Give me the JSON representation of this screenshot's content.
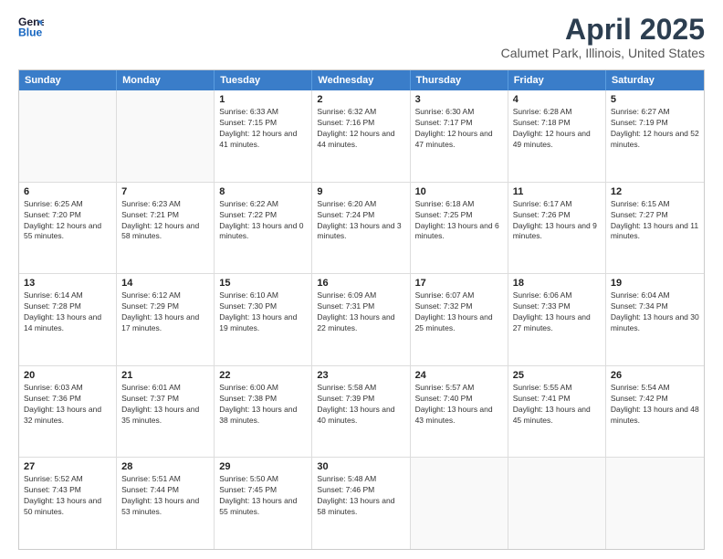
{
  "header": {
    "logo_line1": "General",
    "logo_line2": "Blue",
    "month_title": "April 2025",
    "location": "Calumet Park, Illinois, United States"
  },
  "days_of_week": [
    "Sunday",
    "Monday",
    "Tuesday",
    "Wednesday",
    "Thursday",
    "Friday",
    "Saturday"
  ],
  "weeks": [
    [
      {
        "day": "",
        "text": ""
      },
      {
        "day": "",
        "text": ""
      },
      {
        "day": "1",
        "text": "Sunrise: 6:33 AM\nSunset: 7:15 PM\nDaylight: 12 hours and 41 minutes."
      },
      {
        "day": "2",
        "text": "Sunrise: 6:32 AM\nSunset: 7:16 PM\nDaylight: 12 hours and 44 minutes."
      },
      {
        "day": "3",
        "text": "Sunrise: 6:30 AM\nSunset: 7:17 PM\nDaylight: 12 hours and 47 minutes."
      },
      {
        "day": "4",
        "text": "Sunrise: 6:28 AM\nSunset: 7:18 PM\nDaylight: 12 hours and 49 minutes."
      },
      {
        "day": "5",
        "text": "Sunrise: 6:27 AM\nSunset: 7:19 PM\nDaylight: 12 hours and 52 minutes."
      }
    ],
    [
      {
        "day": "6",
        "text": "Sunrise: 6:25 AM\nSunset: 7:20 PM\nDaylight: 12 hours and 55 minutes."
      },
      {
        "day": "7",
        "text": "Sunrise: 6:23 AM\nSunset: 7:21 PM\nDaylight: 12 hours and 58 minutes."
      },
      {
        "day": "8",
        "text": "Sunrise: 6:22 AM\nSunset: 7:22 PM\nDaylight: 13 hours and 0 minutes."
      },
      {
        "day": "9",
        "text": "Sunrise: 6:20 AM\nSunset: 7:24 PM\nDaylight: 13 hours and 3 minutes."
      },
      {
        "day": "10",
        "text": "Sunrise: 6:18 AM\nSunset: 7:25 PM\nDaylight: 13 hours and 6 minutes."
      },
      {
        "day": "11",
        "text": "Sunrise: 6:17 AM\nSunset: 7:26 PM\nDaylight: 13 hours and 9 minutes."
      },
      {
        "day": "12",
        "text": "Sunrise: 6:15 AM\nSunset: 7:27 PM\nDaylight: 13 hours and 11 minutes."
      }
    ],
    [
      {
        "day": "13",
        "text": "Sunrise: 6:14 AM\nSunset: 7:28 PM\nDaylight: 13 hours and 14 minutes."
      },
      {
        "day": "14",
        "text": "Sunrise: 6:12 AM\nSunset: 7:29 PM\nDaylight: 13 hours and 17 minutes."
      },
      {
        "day": "15",
        "text": "Sunrise: 6:10 AM\nSunset: 7:30 PM\nDaylight: 13 hours and 19 minutes."
      },
      {
        "day": "16",
        "text": "Sunrise: 6:09 AM\nSunset: 7:31 PM\nDaylight: 13 hours and 22 minutes."
      },
      {
        "day": "17",
        "text": "Sunrise: 6:07 AM\nSunset: 7:32 PM\nDaylight: 13 hours and 25 minutes."
      },
      {
        "day": "18",
        "text": "Sunrise: 6:06 AM\nSunset: 7:33 PM\nDaylight: 13 hours and 27 minutes."
      },
      {
        "day": "19",
        "text": "Sunrise: 6:04 AM\nSunset: 7:34 PM\nDaylight: 13 hours and 30 minutes."
      }
    ],
    [
      {
        "day": "20",
        "text": "Sunrise: 6:03 AM\nSunset: 7:36 PM\nDaylight: 13 hours and 32 minutes."
      },
      {
        "day": "21",
        "text": "Sunrise: 6:01 AM\nSunset: 7:37 PM\nDaylight: 13 hours and 35 minutes."
      },
      {
        "day": "22",
        "text": "Sunrise: 6:00 AM\nSunset: 7:38 PM\nDaylight: 13 hours and 38 minutes."
      },
      {
        "day": "23",
        "text": "Sunrise: 5:58 AM\nSunset: 7:39 PM\nDaylight: 13 hours and 40 minutes."
      },
      {
        "day": "24",
        "text": "Sunrise: 5:57 AM\nSunset: 7:40 PM\nDaylight: 13 hours and 43 minutes."
      },
      {
        "day": "25",
        "text": "Sunrise: 5:55 AM\nSunset: 7:41 PM\nDaylight: 13 hours and 45 minutes."
      },
      {
        "day": "26",
        "text": "Sunrise: 5:54 AM\nSunset: 7:42 PM\nDaylight: 13 hours and 48 minutes."
      }
    ],
    [
      {
        "day": "27",
        "text": "Sunrise: 5:52 AM\nSunset: 7:43 PM\nDaylight: 13 hours and 50 minutes."
      },
      {
        "day": "28",
        "text": "Sunrise: 5:51 AM\nSunset: 7:44 PM\nDaylight: 13 hours and 53 minutes."
      },
      {
        "day": "29",
        "text": "Sunrise: 5:50 AM\nSunset: 7:45 PM\nDaylight: 13 hours and 55 minutes."
      },
      {
        "day": "30",
        "text": "Sunrise: 5:48 AM\nSunset: 7:46 PM\nDaylight: 13 hours and 58 minutes."
      },
      {
        "day": "",
        "text": ""
      },
      {
        "day": "",
        "text": ""
      },
      {
        "day": "",
        "text": ""
      }
    ]
  ]
}
